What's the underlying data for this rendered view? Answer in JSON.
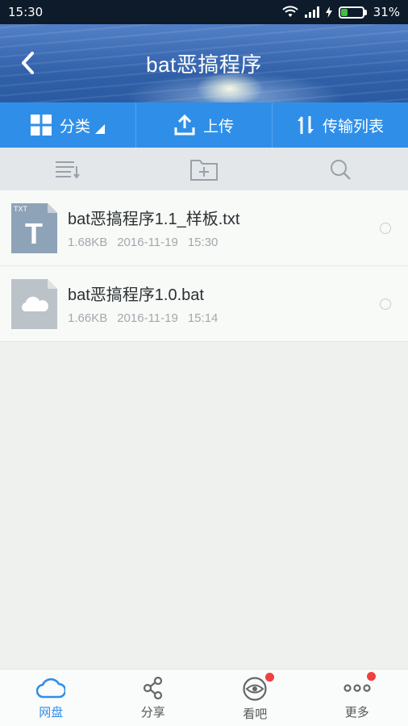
{
  "status": {
    "time": "15:30",
    "battery": "31%",
    "battery_level": 0.31
  },
  "header": {
    "title": "bat恶搞程序"
  },
  "toolbar": {
    "items": [
      {
        "label": "分类",
        "icon": "grid-icon"
      },
      {
        "label": "上传",
        "icon": "upload-icon"
      },
      {
        "label": "传输列表",
        "icon": "transfer-arrows-icon"
      }
    ]
  },
  "actions": [
    {
      "icon": "sort-list-icon"
    },
    {
      "icon": "new-folder-icon"
    },
    {
      "icon": "search-icon"
    }
  ],
  "files": [
    {
      "name": "bat恶搞程序1.1_样板.txt",
      "size": "1.68KB",
      "date": "2016-11-19",
      "time": "15:30",
      "icon": "txt-file-icon",
      "icon_label": "TXT",
      "icon_letter": "T"
    },
    {
      "name": "bat恶搞程序1.0.bat",
      "size": "1.66KB",
      "date": "2016-11-19",
      "time": "15:14",
      "icon": "unknown-file-icon"
    }
  ],
  "bottom_nav": [
    {
      "label": "网盘",
      "icon": "cloud-icon",
      "active": true
    },
    {
      "label": "分享",
      "icon": "share-icon"
    },
    {
      "label": "看吧",
      "icon": "eye-icon"
    },
    {
      "label": "更多",
      "icon": "more-dots-icon"
    }
  ],
  "colors": {
    "accent": "#2f8fe8",
    "badge": "#ef4040"
  }
}
